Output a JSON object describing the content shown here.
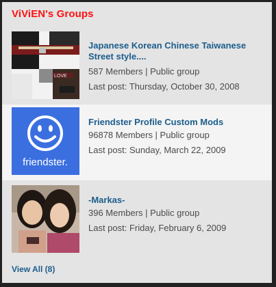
{
  "section": {
    "title": "ViViEN's Groups",
    "view_all": "View All (8)"
  },
  "groups": [
    {
      "name": "Japanese Korean Chinese Taiwanese Street style....",
      "members": "587 Members | Public group",
      "last_post": "Last post: Thursday, October 30, 2008"
    },
    {
      "name": "Friendster Profile Custom Mods",
      "members": "96878 Members | Public group",
      "last_post": "Last post: Sunday, March 22, 2009",
      "logo_text": "friendster."
    },
    {
      "name": "-Markas-",
      "members": "396 Members | Public group",
      "last_post": "Last post: Friday, February 6, 2009"
    }
  ],
  "colors": {
    "title": "#ff1010",
    "link": "#1c5d8c",
    "friendster_blue": "#3b6fe0"
  }
}
